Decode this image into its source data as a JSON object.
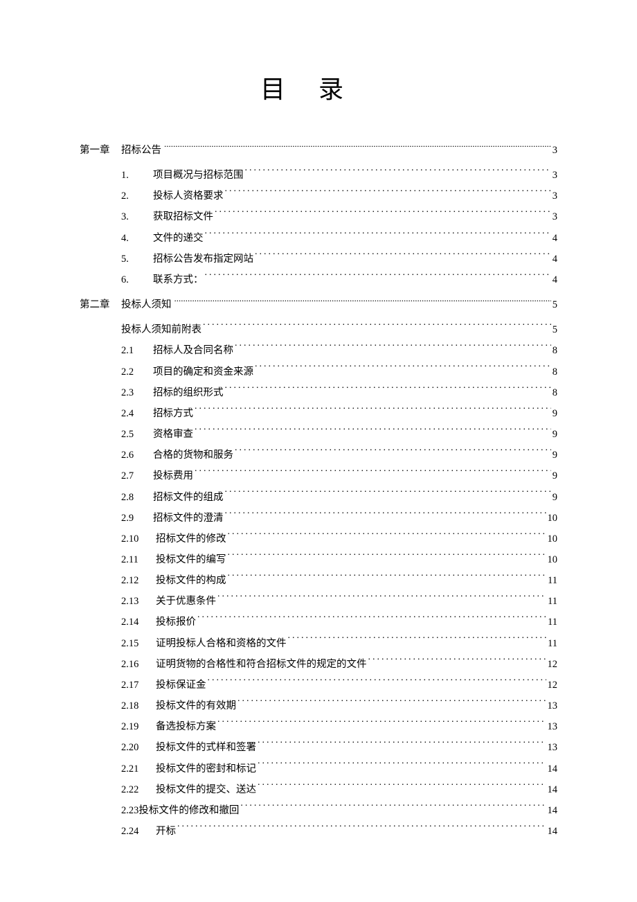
{
  "title": "目录",
  "title_char1": "目",
  "title_char2": "录",
  "chapters": [
    {
      "label": "第一章",
      "title": "招标公告",
      "page": "3",
      "leader_style": "wide-dots",
      "items": [
        {
          "num": "1.",
          "text": "项目概况与招标范围",
          "page": "3"
        },
        {
          "num": "2.",
          "text": "投标人资格要求",
          "page": "3"
        },
        {
          "num": "3.",
          "text": "获取招标文件",
          "page": "3"
        },
        {
          "num": "4.",
          "text": "文件的递交",
          "page": "4"
        },
        {
          "num": "5.",
          "text": "招标公告发布指定网站",
          "page": "4"
        },
        {
          "num": "6.",
          "text": "联系方式：",
          "page": "4"
        }
      ]
    },
    {
      "label": "第二章",
      "title": "投标人须知",
      "page": "5",
      "leader_style": "wide-dots",
      "items": [
        {
          "num": "",
          "text": "投标人须知前附表",
          "page": "5"
        },
        {
          "num": "2.1",
          "text": "招标人及合同名称",
          "page": "8"
        },
        {
          "num": "2.2",
          "text": " 项目的确定和资金来源",
          "page": "8"
        },
        {
          "num": "2.3",
          "text": "招标的组织形式",
          "page": "8"
        },
        {
          "num": "2.4",
          "text": "招标方式",
          "page": "9"
        },
        {
          "num": "2.5",
          "text": "资格审查",
          "page": "9"
        },
        {
          "num": "2.6",
          "text": "合格的货物和服务",
          "page": "9"
        },
        {
          "num": "2.7",
          "text": "投标费用",
          "page": "9"
        },
        {
          "num": "2.8",
          "text": "招标文件的组成",
          "page": "9"
        },
        {
          "num": "2.9",
          "text": "招标文件的澄清",
          "page": "10"
        },
        {
          "num": "2.10",
          "text": "招标文件的修改",
          "page": "10"
        },
        {
          "num": "2.11",
          "text": "投标文件的编写",
          "page": "10"
        },
        {
          "num": "2.12",
          "text": "投标文件的构成",
          "page": "11"
        },
        {
          "num": "2.13",
          "text": "关于优惠条件",
          "page": "11"
        },
        {
          "num": "2.14",
          "text": "投标报价",
          "page": "11"
        },
        {
          "num": "2.15",
          "text": "证明投标人合格和资格的文件",
          "page": "11"
        },
        {
          "num": "2.16",
          "text": "证明货物的合格性和符合招标文件的规定的文件",
          "page": "12"
        },
        {
          "num": "2.17",
          "text": "投标保证金",
          "page": "12"
        },
        {
          "num": "2.18",
          "text": "投标文件的有效期",
          "page": "13"
        },
        {
          "num": "2.19",
          "text": "备选投标方案",
          "page": "13"
        },
        {
          "num": "2.20",
          "text": "投标文件的式样和签署",
          "page": "13"
        },
        {
          "num": "2.21",
          "text": "投标文件的密封和标记",
          "page": "14"
        },
        {
          "num": "2.22",
          "text": "投标文件的提交、送达",
          "page": "14"
        },
        {
          "num": "2.23",
          "text": "投标文件的修改和撤回",
          "page": "14",
          "no_num_space": true
        },
        {
          "num": "2.24",
          "text": "开标",
          "page": "14"
        }
      ]
    }
  ]
}
